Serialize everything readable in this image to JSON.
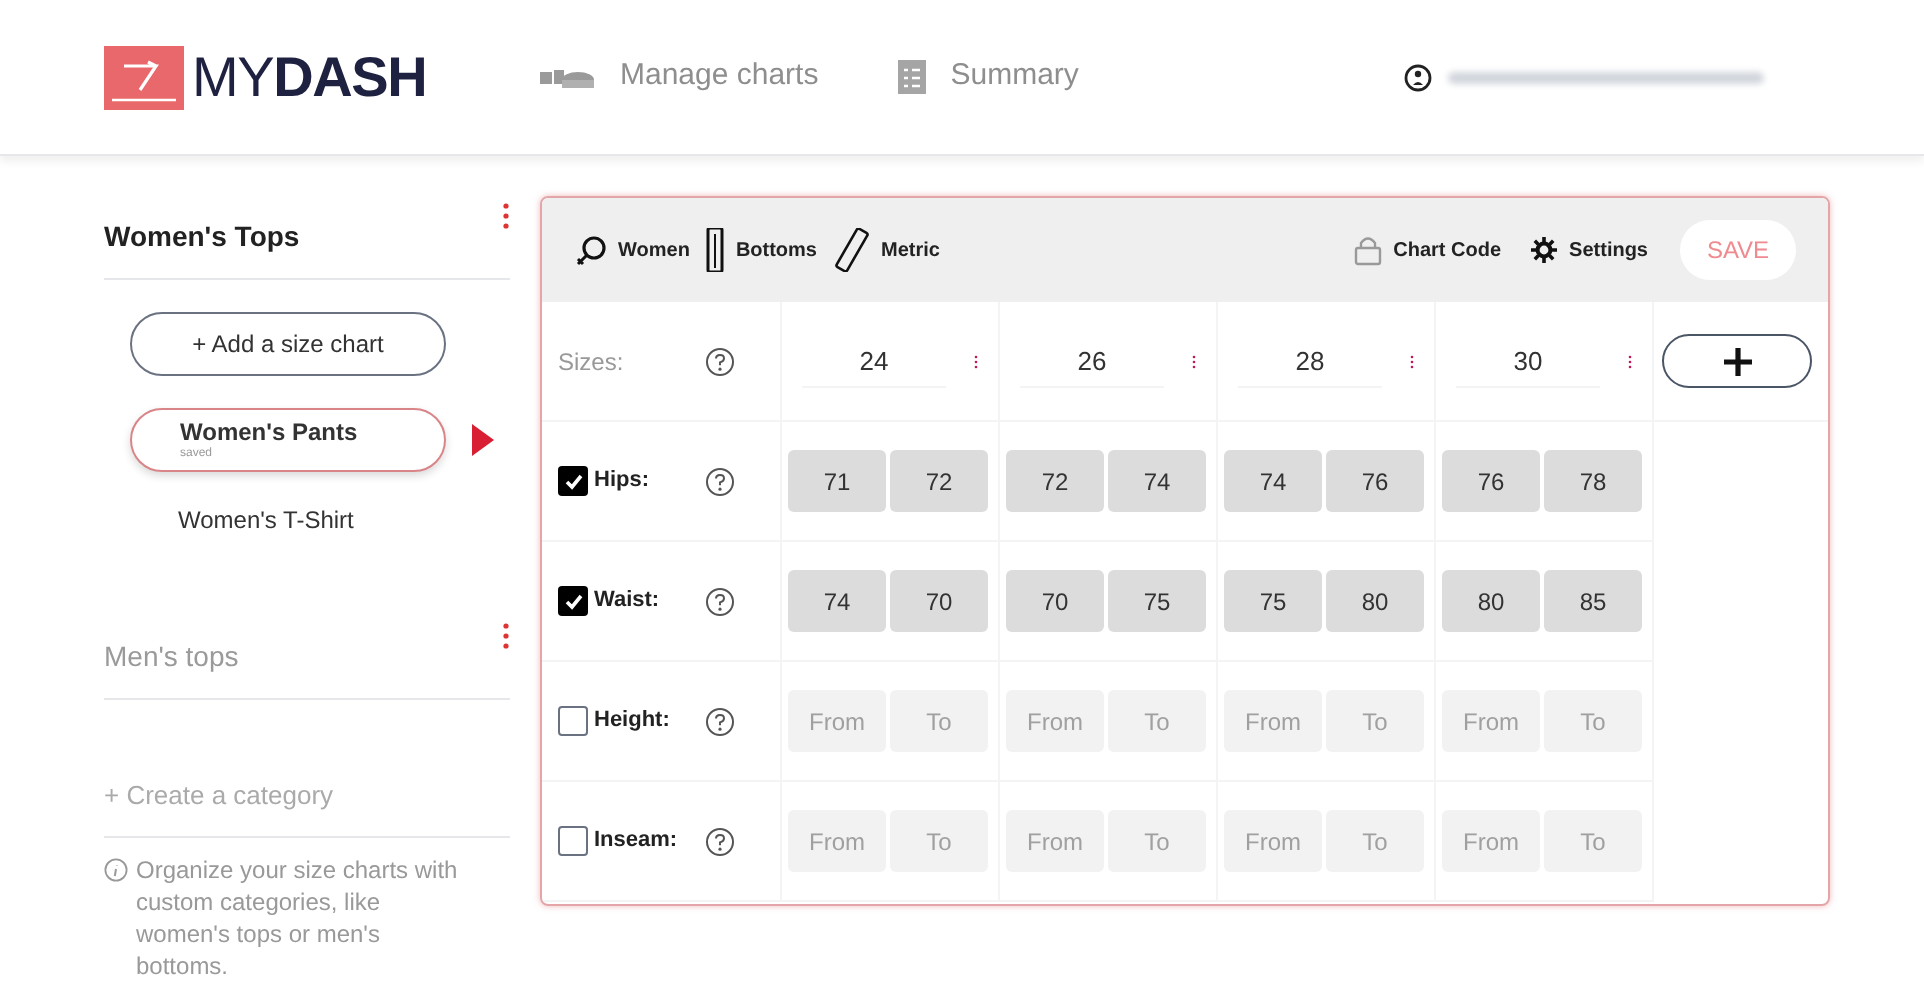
{
  "header": {
    "logo": {
      "light": "MY",
      "bold": "DASH"
    },
    "nav": [
      {
        "label": "Manage charts"
      },
      {
        "label": "Summary"
      }
    ]
  },
  "sidebar": {
    "categories": [
      {
        "title": "Women's Tops",
        "selected": true,
        "add_button": "+ Add a size chart",
        "charts": [
          {
            "name": "Women's Pants",
            "status": "saved",
            "selected": true
          },
          {
            "name": "Women's T-Shirt",
            "selected": false
          }
        ]
      },
      {
        "title": "Men's tops",
        "selected": false
      }
    ],
    "create_category": "+ Create a category",
    "hint": "Organize your size charts with custom categories, like women's tops or men's bottoms."
  },
  "toolbar": {
    "left": [
      {
        "label": "Women"
      },
      {
        "label": "Bottoms"
      },
      {
        "label": "Metric"
      }
    ],
    "right": [
      {
        "label": "Chart Code"
      },
      {
        "label": "Settings"
      }
    ],
    "save": "SAVE"
  },
  "sizes_label": "Sizes:",
  "sizes": [
    "24",
    "26",
    "28",
    "30"
  ],
  "measurements": [
    {
      "label": "Hips:",
      "checked": true,
      "cells": [
        {
          "value": "71"
        },
        {
          "value": "72"
        },
        {
          "value": "72"
        },
        {
          "value": "74"
        },
        {
          "value": "74"
        },
        {
          "value": "76"
        },
        {
          "value": "76"
        },
        {
          "value": "78"
        }
      ]
    },
    {
      "label": "Waist:",
      "checked": true,
      "cells": [
        {
          "value": "74"
        },
        {
          "value": "70"
        },
        {
          "value": "70"
        },
        {
          "value": "75"
        },
        {
          "value": "75"
        },
        {
          "value": "80"
        },
        {
          "value": "80"
        },
        {
          "value": "85"
        }
      ]
    },
    {
      "label": "Height:",
      "checked": false,
      "cells": [
        {
          "placeholder": "From"
        },
        {
          "placeholder": "To"
        },
        {
          "placeholder": "From"
        },
        {
          "placeholder": "To"
        },
        {
          "placeholder": "From"
        },
        {
          "placeholder": "To"
        },
        {
          "placeholder": "From"
        },
        {
          "placeholder": "To"
        }
      ]
    },
    {
      "label": "Inseam:",
      "checked": false,
      "cells": [
        {
          "placeholder": "From"
        },
        {
          "placeholder": "To"
        },
        {
          "placeholder": "From"
        },
        {
          "placeholder": "To"
        },
        {
          "placeholder": "From"
        },
        {
          "placeholder": "To"
        },
        {
          "placeholder": "From"
        },
        {
          "placeholder": "To"
        }
      ]
    }
  ]
}
